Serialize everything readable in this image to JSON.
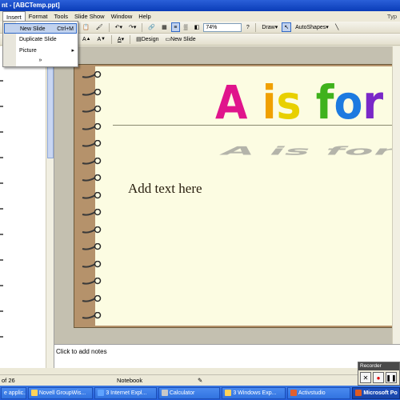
{
  "window": {
    "title": "nt - [ABCTemp.ppt]"
  },
  "menubar": {
    "items": [
      "Insert",
      "Format",
      "Tools",
      "Slide Show",
      "Window",
      "Help"
    ],
    "right_text": "Typ"
  },
  "insert_menu": {
    "items": [
      {
        "label": "New Slide",
        "shortcut": "Ctrl+M"
      },
      {
        "label": "Duplicate Slide",
        "shortcut": ""
      },
      {
        "label": "Picture",
        "shortcut": "▸"
      }
    ],
    "more": "»"
  },
  "toolbar": {
    "zoom": "74%",
    "draw_label": "Draw",
    "autoshapes_label": "AutoShapes",
    "design_label": "Design",
    "new_slide_label": "New Slide"
  },
  "slide": {
    "title_letters": [
      {
        "ch": "A",
        "color": "#e0148c"
      },
      {
        "ch": " ",
        "color": "#000000"
      },
      {
        "ch": "i",
        "color": "#f0a000"
      },
      {
        "ch": "s",
        "color": "#e8d000"
      },
      {
        "ch": " ",
        "color": "#000000"
      },
      {
        "ch": "f",
        "color": "#3fb21c"
      },
      {
        "ch": "o",
        "color": "#1c7ae0"
      },
      {
        "ch": "r",
        "color": "#7a28c8"
      }
    ],
    "body_placeholder": "Add text here"
  },
  "notes": {
    "placeholder": "Click to add notes"
  },
  "status": {
    "slide_count": "of 26",
    "design": "Notebook"
  },
  "recorder": {
    "title": "Recorder"
  },
  "taskbar": {
    "items": [
      {
        "label": "e applic...",
        "active": false
      },
      {
        "label": "Novell GroupWis...",
        "active": false
      },
      {
        "label": "3 Internet Expl...",
        "active": false
      },
      {
        "label": "Calculator",
        "active": false
      },
      {
        "label": "3 Windows Exp...",
        "active": false
      },
      {
        "label": "Activstudio",
        "active": false
      },
      {
        "label": "Microsoft Po",
        "active": true
      }
    ]
  },
  "colors": {
    "paper": "#fcfce2",
    "frame": "#b5926b",
    "accent_select": "#c1d2ee"
  }
}
